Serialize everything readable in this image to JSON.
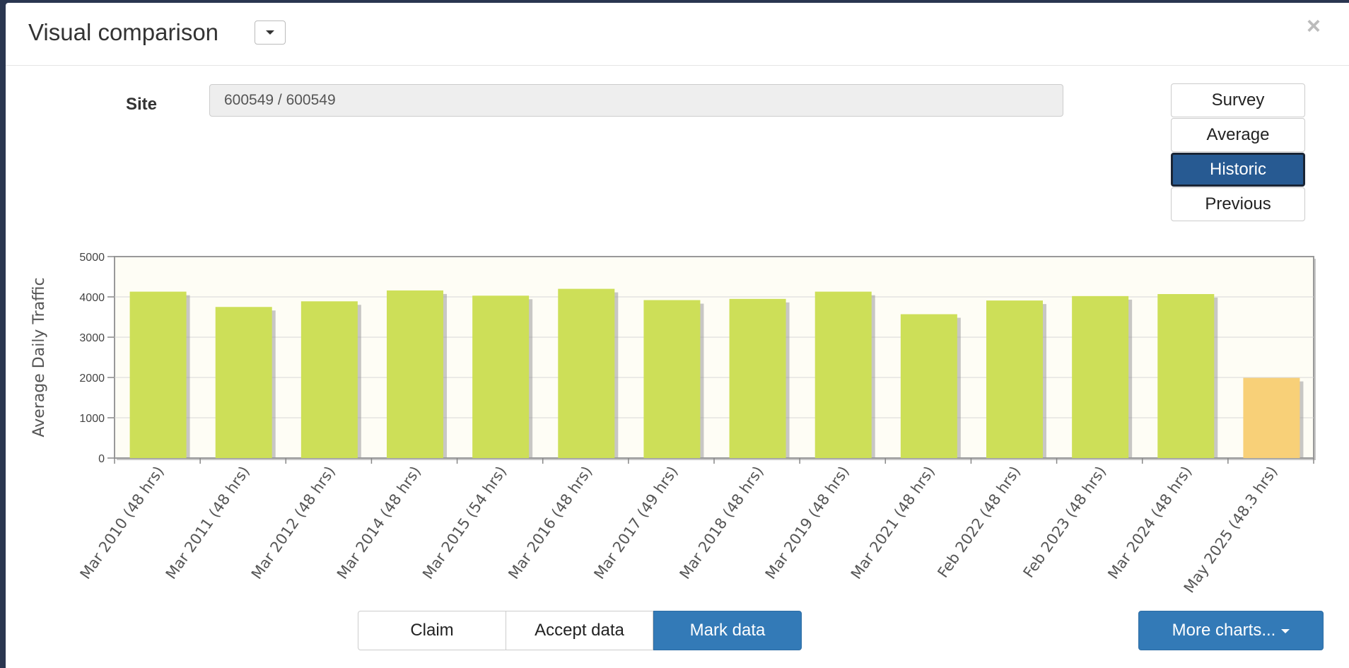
{
  "modal": {
    "title": "Visual comparison",
    "close_label": "×"
  },
  "site": {
    "label": "Site",
    "value": "600549 / 600549"
  },
  "modes": [
    {
      "label": "Survey",
      "active": false
    },
    {
      "label": "Average",
      "active": false
    },
    {
      "label": "Historic",
      "active": true
    },
    {
      "label": "Previous",
      "active": false
    }
  ],
  "actions": {
    "claim": "Claim",
    "accept": "Accept data",
    "mark": "Mark data",
    "more": "More charts..."
  },
  "colors": {
    "bar": "#cddf58",
    "bar_highlight": "#f8d078",
    "plot_bg": "#fefdf5",
    "primary": "#337ab7"
  },
  "chart_data": {
    "type": "bar",
    "ylabel": "Average Daily Traffic",
    "xlabel": "",
    "ylim": [
      0,
      5000
    ],
    "yticks": [
      0,
      1000,
      2000,
      3000,
      4000,
      5000
    ],
    "grid": true,
    "categories": [
      "Mar 2010 (48 hrs)",
      "Mar 2011 (48 hrs)",
      "Mar 2012 (48 hrs)",
      "Mar 2014 (48 hrs)",
      "Mar 2015 (54 hrs)",
      "Mar 2016 (48 hrs)",
      "Mar 2017 (49 hrs)",
      "Mar 2018 (48 hrs)",
      "Mar 2019 (48 hrs)",
      "Mar 2021 (48 hrs)",
      "Feb 2022 (48 hrs)",
      "Feb 2023 (48 hrs)",
      "Mar 2024 (48 hrs)",
      "May 2025 (48.3 hrs)"
    ],
    "values": [
      4130,
      3750,
      3890,
      4160,
      4030,
      4200,
      3920,
      3950,
      4130,
      3570,
      3910,
      4020,
      4070,
      1990
    ],
    "highlighted": [
      false,
      false,
      false,
      false,
      false,
      false,
      false,
      false,
      false,
      false,
      false,
      false,
      false,
      true
    ]
  }
}
